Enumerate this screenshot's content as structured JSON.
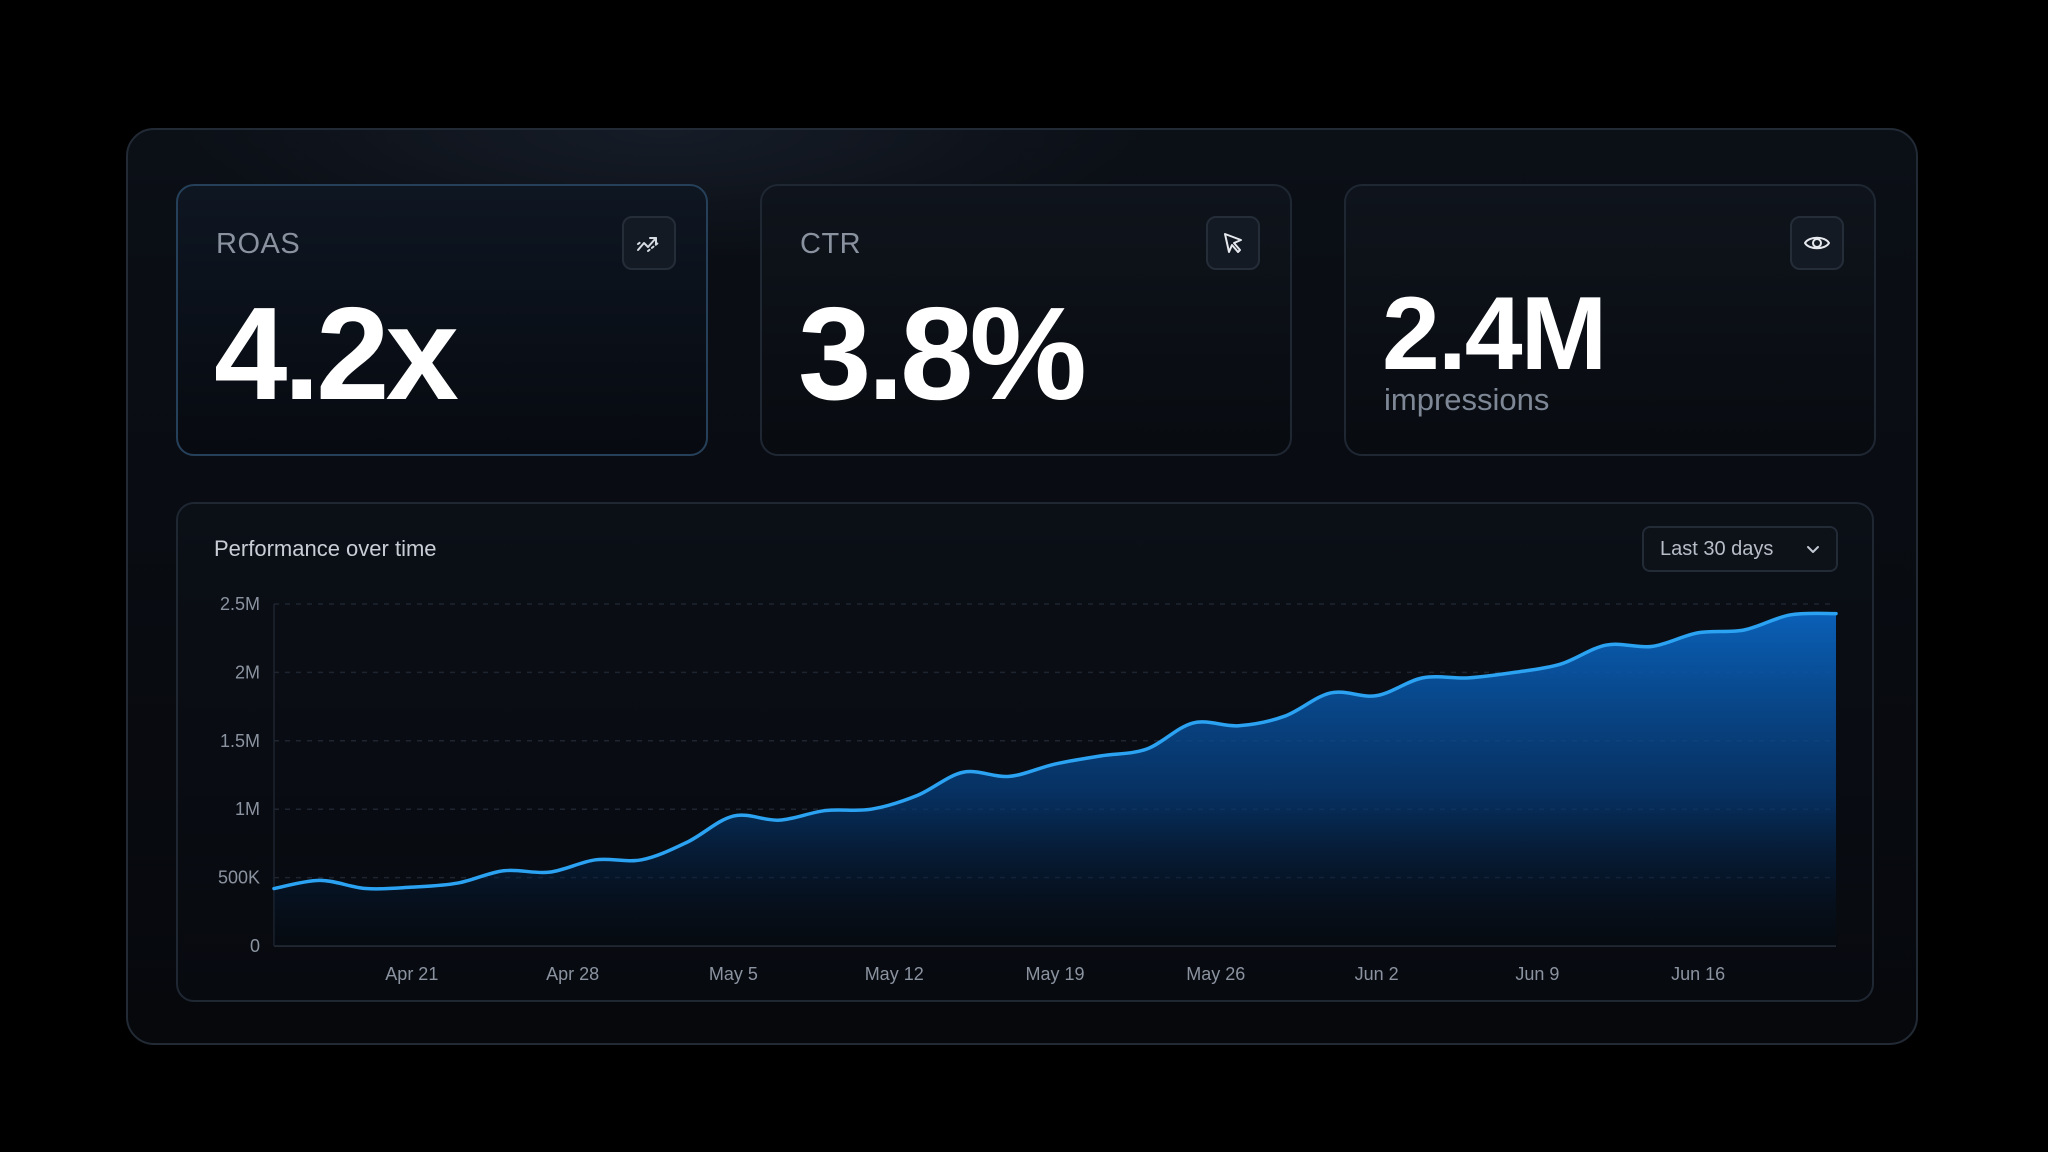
{
  "cards": [
    {
      "label": "ROAS",
      "value": "4.2x",
      "icon": "trend-up-icon"
    },
    {
      "label": "CTR",
      "value": "3.8%",
      "icon": "cursor-icon"
    },
    {
      "value": "2.4M",
      "sublabel": "impressions",
      "icon": "eye-icon"
    }
  ],
  "chart_panel": {
    "title": "Performance over time",
    "range_selector": {
      "selected": "Last 30 days",
      "icon": "chevron-down-icon"
    }
  },
  "colors": {
    "accent": "#2ba3f2",
    "area_top": "#0a60b8",
    "background": "#000000"
  },
  "chart_data": {
    "type": "area",
    "title": "Performance over time",
    "xlabel": "",
    "ylabel": "",
    "ylim": [
      0,
      2500000
    ],
    "xlim": [
      "2024-04-15",
      "2024-06-22"
    ],
    "y_ticks": [
      {
        "value": 0,
        "label": "0"
      },
      {
        "value": 500000,
        "label": "500K"
      },
      {
        "value": 1000000,
        "label": "1M"
      },
      {
        "value": 1500000,
        "label": "1.5M"
      },
      {
        "value": 2000000,
        "label": "2M"
      },
      {
        "value": 2500000,
        "label": "2.5M"
      }
    ],
    "x_ticks": [
      {
        "date": "2024-04-21",
        "label": "Apr 21"
      },
      {
        "date": "2024-04-28",
        "label": "Apr 28"
      },
      {
        "date": "2024-05-05",
        "label": "May 5"
      },
      {
        "date": "2024-05-12",
        "label": "May 12"
      },
      {
        "date": "2024-05-19",
        "label": "May 19"
      },
      {
        "date": "2024-05-26",
        "label": "May 26"
      },
      {
        "date": "2024-06-02",
        "label": "Jun 2"
      },
      {
        "date": "2024-06-09",
        "label": "Jun 9"
      },
      {
        "date": "2024-06-16",
        "label": "Jun 16"
      }
    ],
    "grid": true,
    "series": [
      {
        "x": [
          "2024-04-15",
          "2024-04-17",
          "2024-04-19",
          "2024-04-21",
          "2024-04-23",
          "2024-04-25",
          "2024-04-27",
          "2024-04-29",
          "2024-05-01",
          "2024-05-03",
          "2024-05-05",
          "2024-05-07",
          "2024-05-09",
          "2024-05-11",
          "2024-05-13",
          "2024-05-15",
          "2024-05-17",
          "2024-05-19",
          "2024-05-21",
          "2024-05-23",
          "2024-05-25",
          "2024-05-27",
          "2024-05-29",
          "2024-05-31",
          "2024-06-02",
          "2024-06-04",
          "2024-06-06",
          "2024-06-08",
          "2024-06-10",
          "2024-06-12",
          "2024-06-14",
          "2024-06-16",
          "2024-06-18",
          "2024-06-20",
          "2024-06-22"
        ],
        "values": [
          420000,
          480000,
          420000,
          430000,
          460000,
          550000,
          540000,
          630000,
          630000,
          760000,
          950000,
          920000,
          990000,
          1000000,
          1100000,
          1270000,
          1240000,
          1330000,
          1390000,
          1440000,
          1630000,
          1610000,
          1680000,
          1850000,
          1830000,
          1960000,
          1960000,
          2000000,
          2060000,
          2200000,
          2190000,
          2290000,
          2310000,
          2420000,
          2430000
        ]
      }
    ]
  }
}
